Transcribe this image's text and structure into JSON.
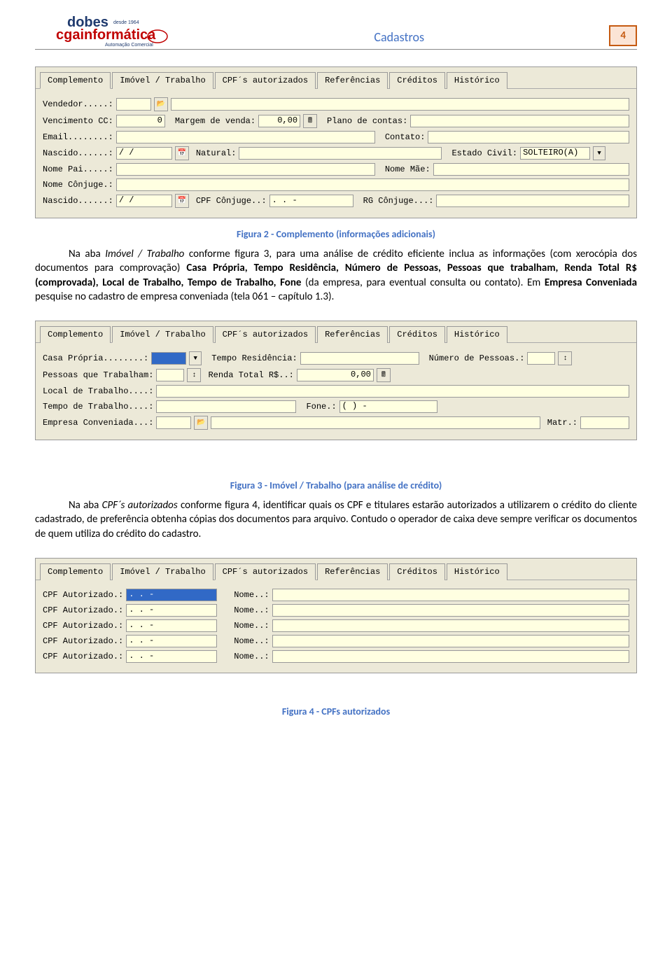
{
  "header": {
    "logo_top": "dobes",
    "logo_since": "desde 1964",
    "logo_bottom": "cgainformática",
    "logo_sub": "Automação Comercial",
    "title": "Cadastros",
    "page_number": "4"
  },
  "panel1": {
    "tabs": [
      "Complemento",
      "Imóvel / Trabalho",
      "CPF´s autorizados",
      "Referências",
      "Créditos",
      "Histórico"
    ],
    "active_tab": 0,
    "fields": {
      "vendedor_lbl": "Vendedor.....:",
      "vendedor_val": "",
      "vencimento_lbl": "Vencimento CC:",
      "vencimento_val": "0",
      "margem_lbl": "Margem de venda:",
      "margem_val": "0,00",
      "plano_lbl": "Plano de contas:",
      "plano_val": "",
      "email_lbl": "Email........:",
      "email_val": "",
      "contato_lbl": "Contato:",
      "contato_val": "",
      "nascido_lbl": "Nascido......:",
      "nascido_val": "  /  /",
      "natural_lbl": "Natural:",
      "natural_val": "",
      "estado_lbl": "Estado Civil:",
      "estado_val": "SOLTEIRO(A)",
      "nomepai_lbl": "Nome Pai.....:",
      "nomepai_val": "",
      "nomemae_lbl": "Nome Mãe:",
      "nomemae_val": "",
      "conjuge_lbl": "Nome Cônjuge.:",
      "conjuge_val": "",
      "nascido2_lbl": "Nascido......:",
      "nascido2_val": "  /  /",
      "cpfconj_lbl": "CPF Cônjuge..:",
      "cpfconj_val": "   .   .   -",
      "rgconj_lbl": "RG Cônjuge...:",
      "rgconj_val": ""
    }
  },
  "caption1": "Figura 2 - Complemento (informações adicionais)",
  "para1_a": "Na aba ",
  "para1_b": "Imóvel / Trabalho",
  "para1_c": " conforme figura 3, para uma análise de crédito eficiente inclua as informações (com xerocópia dos documentos para comprovação) ",
  "para1_d": "Casa Própria, Tempo Residência, Número de Pessoas, Pessoas que trabalham, Renda Total R$ (comprovada), Local de Trabalho, Tempo de Trabalho, Fone",
  "para1_e": " (da empresa, para eventual consulta ou contato). Em ",
  "para1_f": "Empresa Conveniada",
  "para1_g": " pesquise no cadastro de empresa conveniada (tela 061 – capítulo 1.3).",
  "panel2": {
    "tabs": [
      "Complemento",
      "Imóvel / Trabalho",
      "CPF´s autorizados",
      "Referências",
      "Créditos",
      "Histórico"
    ],
    "active_tab": 1,
    "fields": {
      "casa_lbl": "Casa Própria........:",
      "tempores_lbl": "Tempo Residência:",
      "tempores_val": "",
      "numpes_lbl": "Número de Pessoas.:",
      "numpes_val": "",
      "pessoastrab_lbl": "Pessoas que Trabalham:",
      "pessoastrab_val": "",
      "rendatot_lbl": "Renda Total R$..:",
      "rendatot_val": "0,00",
      "localtrab_lbl": "Local de Trabalho....:",
      "localtrab_val": "",
      "tempotrab_lbl": "Tempo de Trabalho....:",
      "tempotrab_val": "",
      "fone_lbl": "Fone.:",
      "fone_val": "(  )    -",
      "empconv_lbl": "Empresa Conveniada...:",
      "empconv_val": "",
      "matr_lbl": "Matr.:",
      "matr_val": ""
    }
  },
  "caption2": "Figura 3 - Imóvel / Trabalho (para análise de crédito)",
  "para2_a": "Na aba ",
  "para2_b": "CPF´s autorizados",
  "para2_c": " conforme figura 4, identificar quais os CPF e titulares estarão autorizados a utilizarem o crédito do cliente cadastrado, de preferência obtenha cópias dos documentos para arquivo. Contudo o operador de caixa deve sempre verificar os documentos de quem utiliza do crédito do cadastro.",
  "panel3": {
    "tabs": [
      "Complemento",
      "Imóvel / Trabalho",
      "CPF´s autorizados",
      "Referências",
      "Créditos",
      "Histórico"
    ],
    "active_tab": 2,
    "rows": [
      {
        "cpf_lbl": "CPF Autorizado.:",
        "cpf_val": "   .   .   -",
        "nome_lbl": "Nome..:",
        "nome_val": "",
        "first": true
      },
      {
        "cpf_lbl": "CPF Autorizado.:",
        "cpf_val": "   .   .   -",
        "nome_lbl": "Nome..:",
        "nome_val": ""
      },
      {
        "cpf_lbl": "CPF Autorizado.:",
        "cpf_val": "   .   .   -",
        "nome_lbl": "Nome..:",
        "nome_val": ""
      },
      {
        "cpf_lbl": "CPF Autorizado.:",
        "cpf_val": "   .   .   -",
        "nome_lbl": "Nome..:",
        "nome_val": ""
      },
      {
        "cpf_lbl": "CPF Autorizado.:",
        "cpf_val": "   .   .   -",
        "nome_lbl": "Nome..:",
        "nome_val": ""
      }
    ]
  },
  "caption3": "Figura 4 - CPFs autorizados",
  "icons": {
    "folder": "📂",
    "calc": "🖩",
    "cal": "📅",
    "spin": "↕",
    "down": "▼"
  }
}
